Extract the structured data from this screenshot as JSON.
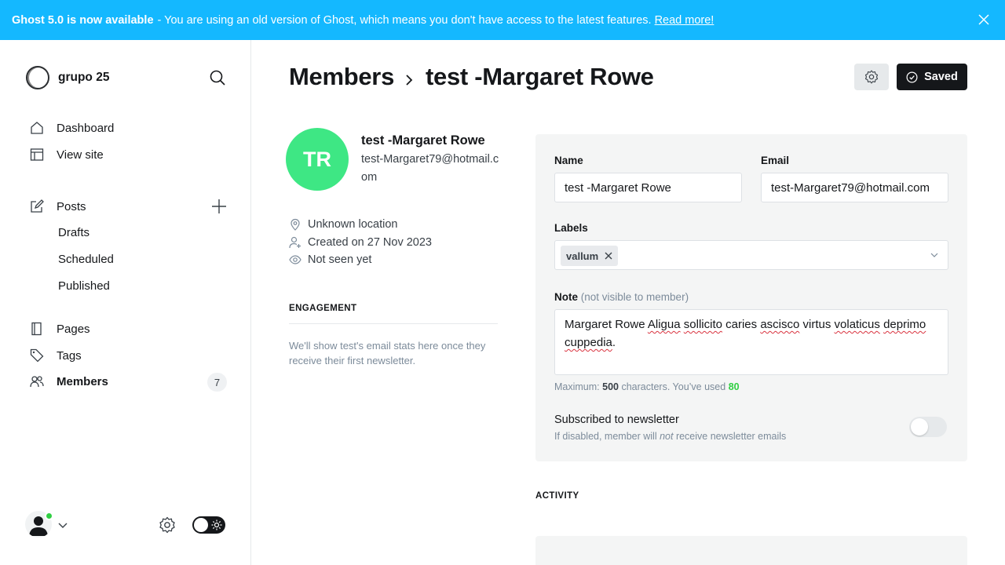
{
  "banner": {
    "strong": "Ghost 5.0 is now available",
    "message": "- You are using an old version of Ghost, which means you don't have access to the latest features.",
    "link": "Read more!"
  },
  "sidebar": {
    "site_name": "grupo 25",
    "items": [
      {
        "label": "Dashboard",
        "icon": "home-icon"
      },
      {
        "label": "View site",
        "icon": "view-site-icon"
      },
      {
        "label": "Posts",
        "icon": "edit-icon"
      },
      {
        "label": "Drafts"
      },
      {
        "label": "Scheduled"
      },
      {
        "label": "Published"
      },
      {
        "label": "Pages",
        "icon": "page-icon"
      },
      {
        "label": "Tags",
        "icon": "tag-icon"
      },
      {
        "label": "Members",
        "icon": "members-icon",
        "count": "7"
      }
    ]
  },
  "header": {
    "breadcrumb_parent": "Members",
    "breadcrumb_current": "test -Margaret Rowe",
    "saved_label": "Saved"
  },
  "member": {
    "initials": "TR",
    "name": "test -Margaret Rowe",
    "email": "test-Margaret79@hotmail.com",
    "location": "Unknown location",
    "created": "Created on 27 Nov 2023",
    "seen": "Not seen yet",
    "engagement_title": "ENGAGEMENT",
    "engagement_text": "We'll show test's email stats here once they receive their first newsletter."
  },
  "form": {
    "name_label": "Name",
    "name_value": "test -Margaret Rowe",
    "email_label": "Email",
    "email_value": "test-Margaret79@hotmail.com",
    "labels_label": "Labels",
    "label_chip": "vallum",
    "note_label": "Note",
    "note_hint": "(not visible to member)",
    "note_words": [
      "Margaret Rowe ",
      "Aligua",
      " ",
      "sollicito",
      " caries ",
      "ascisco",
      " virtus ",
      "volaticus",
      " ",
      "deprimo",
      " ",
      "cuppedia",
      "."
    ],
    "max_prefix": "Maximum:",
    "max_value": "500",
    "max_mid": "characters. You’ve used",
    "used_value": "80",
    "newsletter_title": "Subscribed to newsletter",
    "newsletter_desc_a": "If disabled, member will ",
    "newsletter_desc_em": "not",
    "newsletter_desc_b": " receive newsletter emails",
    "newsletter_enabled": false
  },
  "activity": {
    "title": "ACTIVITY"
  },
  "colors": {
    "banner": "#14b8ff",
    "avatar": "#3ee784",
    "online": "#30cf43"
  }
}
